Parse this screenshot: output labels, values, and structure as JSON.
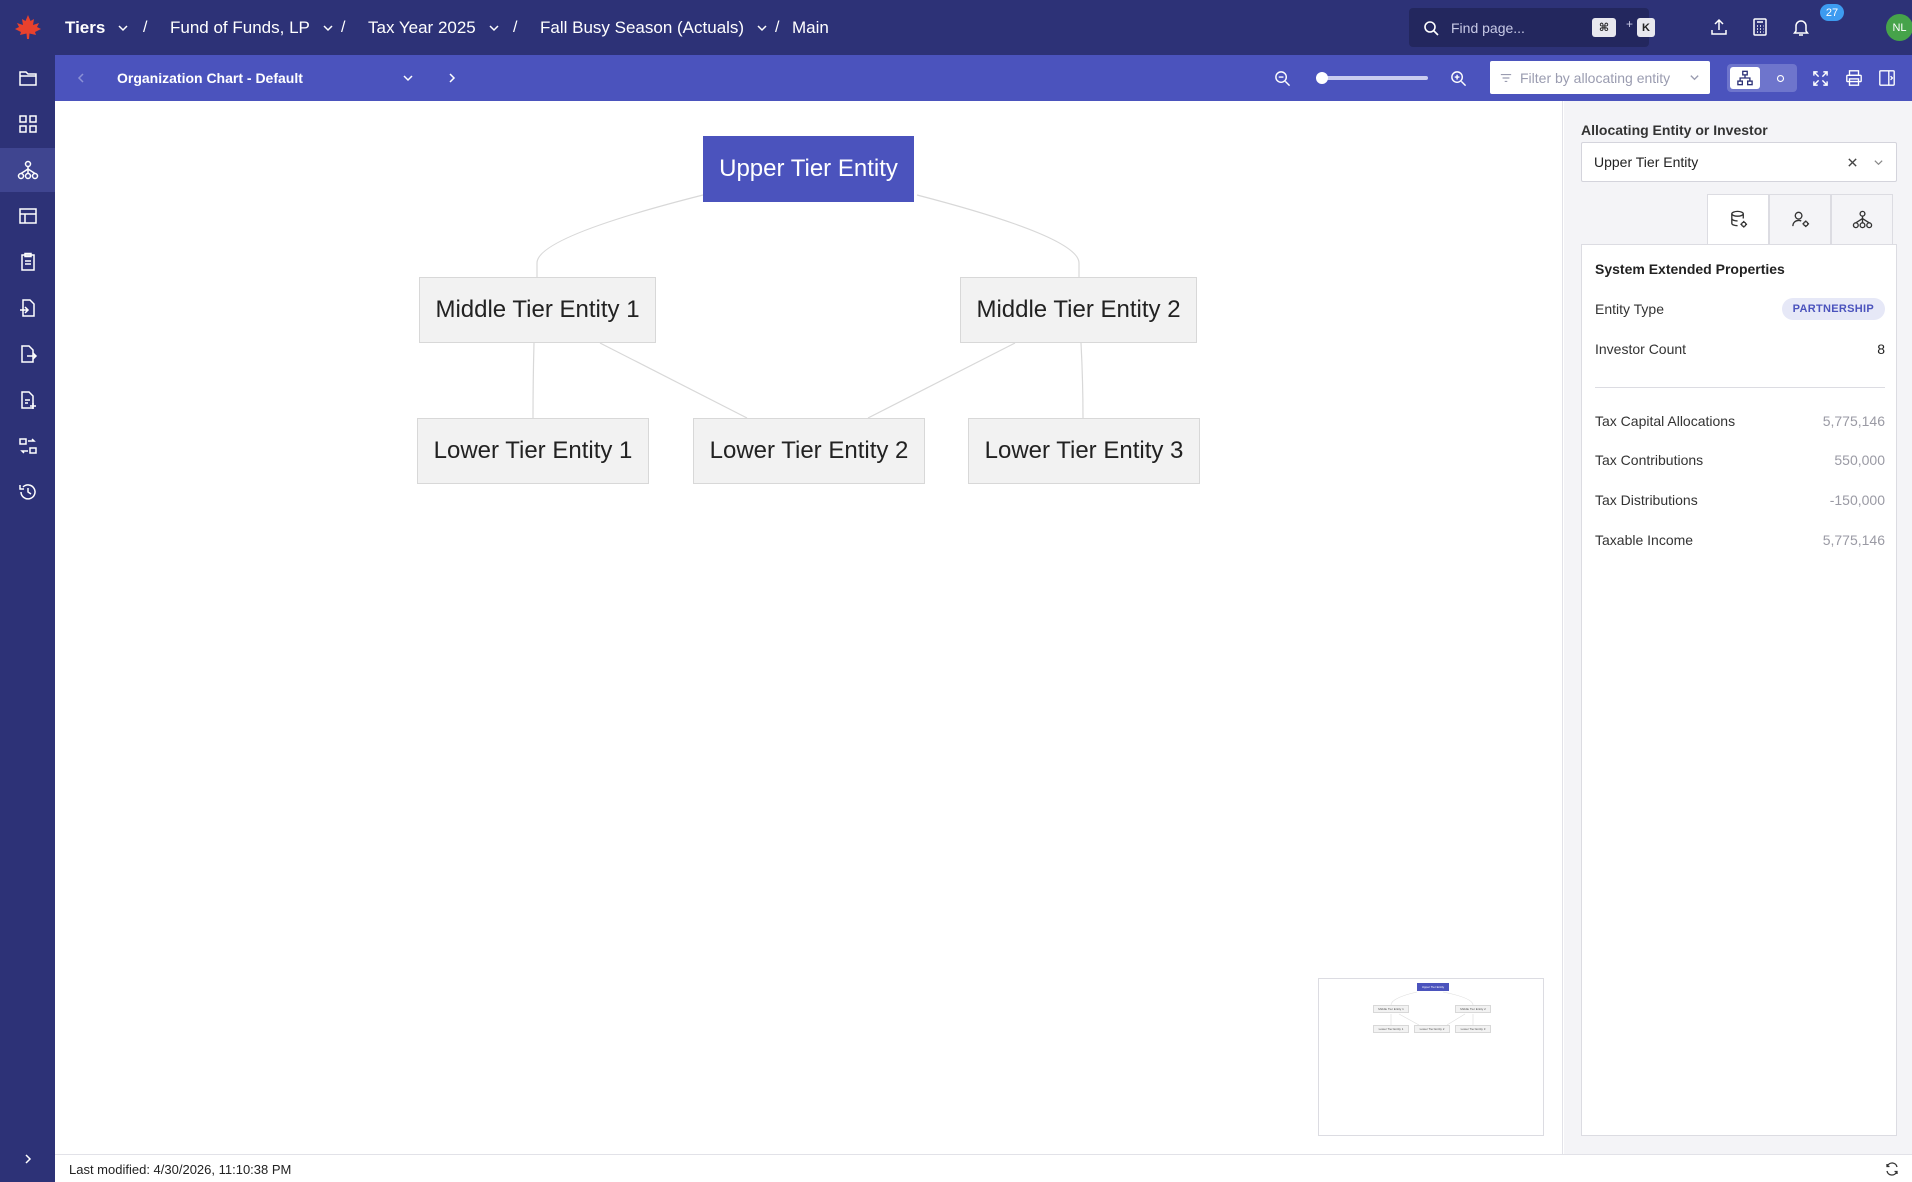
{
  "topbar": {
    "app_name": "Tiers",
    "breadcrumbs": [
      "Fund of Funds, LP",
      "Tax Year 2025",
      "Fall Busy Season (Actuals)",
      "Main"
    ],
    "separator": "/",
    "search_placeholder": "Find page...",
    "shortcut_key_1": "⌘",
    "shortcut_plus": "+",
    "shortcut_key_2": "K",
    "notification_count": "27",
    "user_initials": "NL"
  },
  "toolbar": {
    "chart_title": "Organization Chart - Default",
    "filter_placeholder": "Filter by allocating entity"
  },
  "org_chart": {
    "root": "Upper Tier Entity",
    "middle": [
      "Middle Tier Entity 1",
      "Middle Tier Entity 2"
    ],
    "lower": [
      "Lower Tier Entity 1",
      "Lower Tier Entity 2",
      "Lower Tier Entity 3"
    ]
  },
  "right_panel": {
    "selector_label": "Allocating Entity or Investor",
    "selected_entity": "Upper Tier Entity",
    "section_title": "System Extended Properties",
    "entity_type_label": "Entity Type",
    "entity_type_value": "PARTNERSHIP",
    "investor_count_label": "Investor Count",
    "investor_count_value": "8",
    "financials": [
      {
        "label": "Tax Capital Allocations",
        "value": "5,775,146"
      },
      {
        "label": "Tax Contributions",
        "value": "550,000"
      },
      {
        "label": "Tax Distributions",
        "value": "-150,000"
      },
      {
        "label": "Taxable Income",
        "value": "5,775,146"
      }
    ]
  },
  "statusbar": {
    "last_modified": "Last modified: 4/30/2026, 11:10:38 PM"
  },
  "colors": {
    "nav_bg": "#2d3277",
    "toolbar_bg": "#4b53bd",
    "root_node": "#4b53bd",
    "avatar": "#46a34a",
    "badge": "#3d9bf0"
  }
}
